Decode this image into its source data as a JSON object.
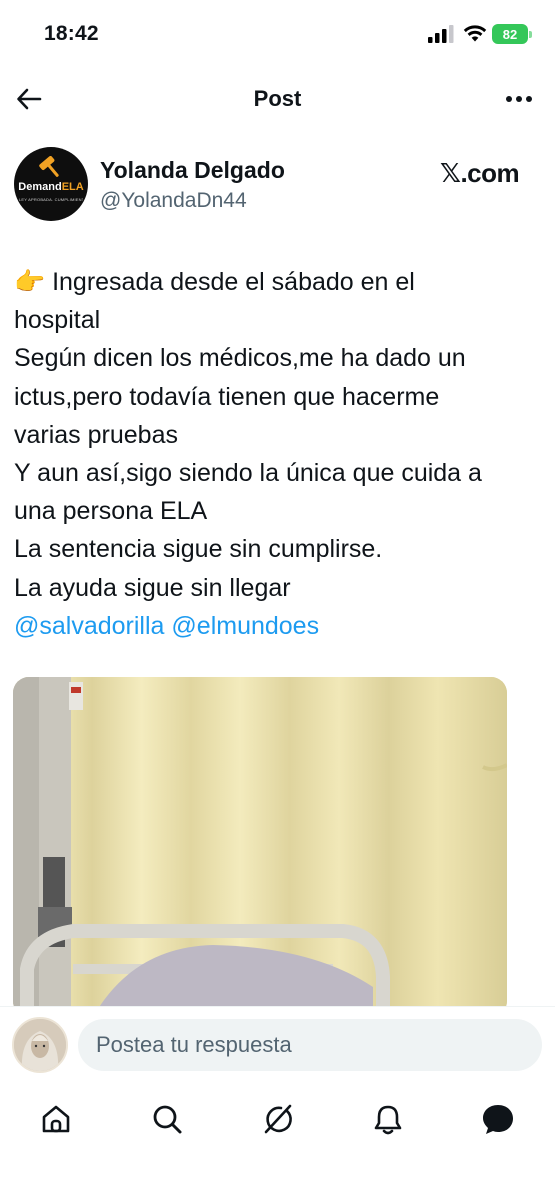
{
  "status_bar": {
    "time": "18:42",
    "battery": "82"
  },
  "header": {
    "title": "Post"
  },
  "author": {
    "name": "Yolanda Delgado",
    "handle": "@YolandaDn44",
    "avatar_logo_text": "DemandELA",
    "avatar_logo_subtext": "LEY APROBADA. CUMPLIMIENTO YA."
  },
  "watermark": "𝕏.com",
  "tweet": {
    "lines": [
      "👉 Ingresada desde el sábado en el",
      "hospital",
      "Según dicen los médicos,me ha dado un",
      "ictus,pero todavía tienen que hacerme",
      "varias pruebas",
      "Y aun así,sigo siendo la única que cuida a",
      "una persona ELA",
      "La sentencia sigue sin cumplirse.",
      "La ayuda sigue sin llegar"
    ],
    "mentions": [
      "@salvadorilla",
      "@elmundoes"
    ]
  },
  "reply": {
    "placeholder": "Postea tu respuesta"
  },
  "bottom_nav": {
    "icons": [
      "home-icon",
      "search-icon",
      "grok-icon",
      "notifications-icon",
      "messages-icon"
    ]
  },
  "colors": {
    "accent": "#1d9bf0",
    "text": "#0f1419",
    "secondary": "#536471",
    "battery": "#34c759"
  }
}
